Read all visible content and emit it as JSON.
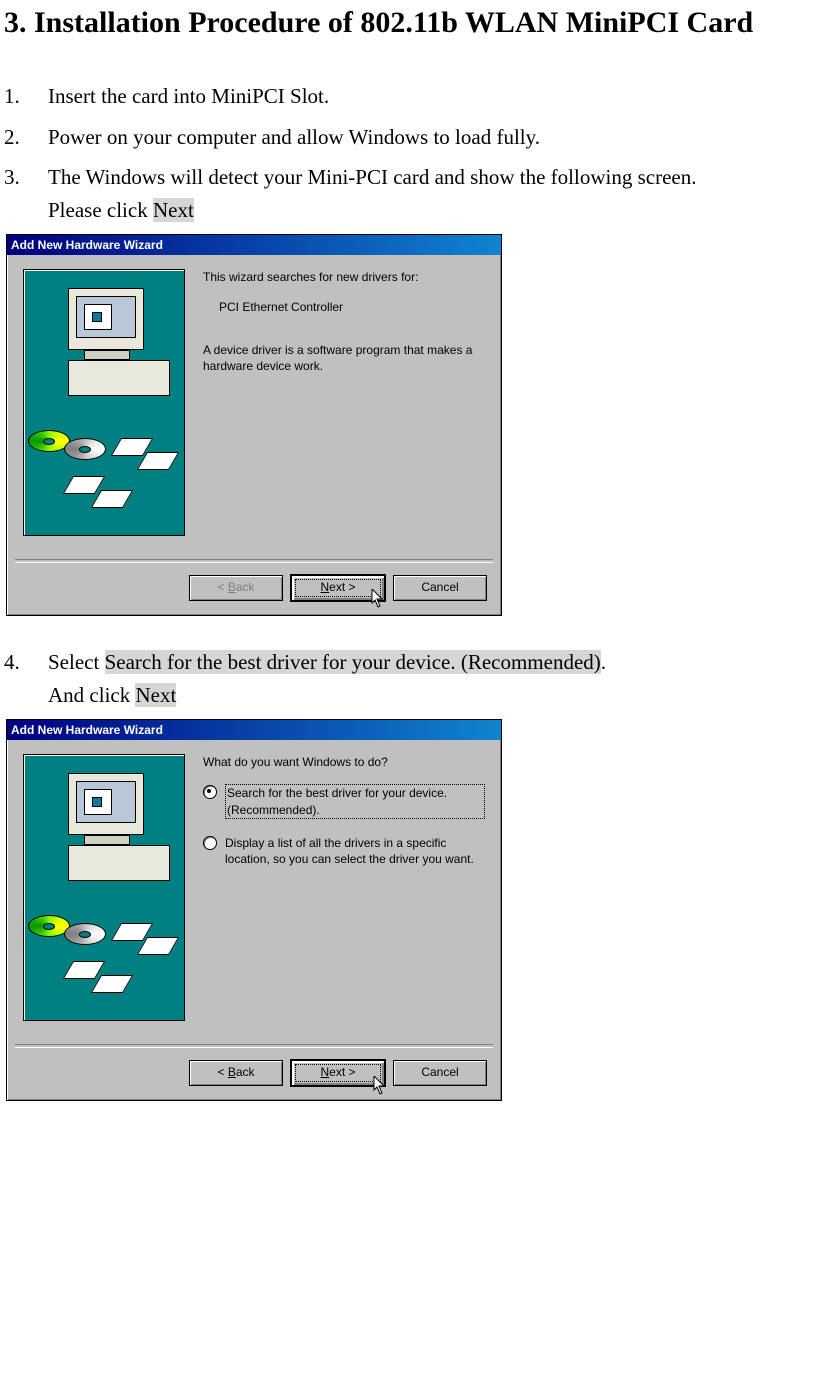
{
  "heading": "3. Installation Procedure of 802.11b WLAN MiniPCI Card",
  "steps": {
    "s1": {
      "num": "1.",
      "text": "Insert the card into MiniPCI Slot."
    },
    "s2": {
      "num": "2.",
      "text": "Power on your computer and allow Windows to load fully."
    },
    "s3": {
      "num": "3.",
      "line1": "The Windows will detect your Mini-PCI card and show the following screen.",
      "line2a": "Please click ",
      "line2_hl": "Next"
    },
    "s4": {
      "num": "4.",
      "line1a": "Select ",
      "line1_hl": "Search for the best driver for your device. (Recommended)",
      "line1b": ".",
      "line2a": "And click ",
      "line2_hl": "Next"
    }
  },
  "dlg1": {
    "title": "Add New Hardware Wizard",
    "p1": "This wizard searches for new drivers for:",
    "p2": "PCI Ethernet Controller",
    "p3": "A device driver is a software program that makes a hardware device work.",
    "back_u": "B",
    "back_r": "ack",
    "next_l": "N",
    "next_r": "ext >",
    "cancel": "Cancel"
  },
  "dlg2": {
    "title": "Add New Hardware Wizard",
    "q": "What do you want Windows to do?",
    "opt1": "Search for the best driver for your device. (Recommended).",
    "opt2": "Display a list of all the drivers in a specific location, so you can select the driver you want.",
    "back_l": "< ",
    "back_u": "B",
    "back_r": "ack",
    "next_l": "N",
    "next_r": "ext >",
    "cancel": "Cancel"
  }
}
